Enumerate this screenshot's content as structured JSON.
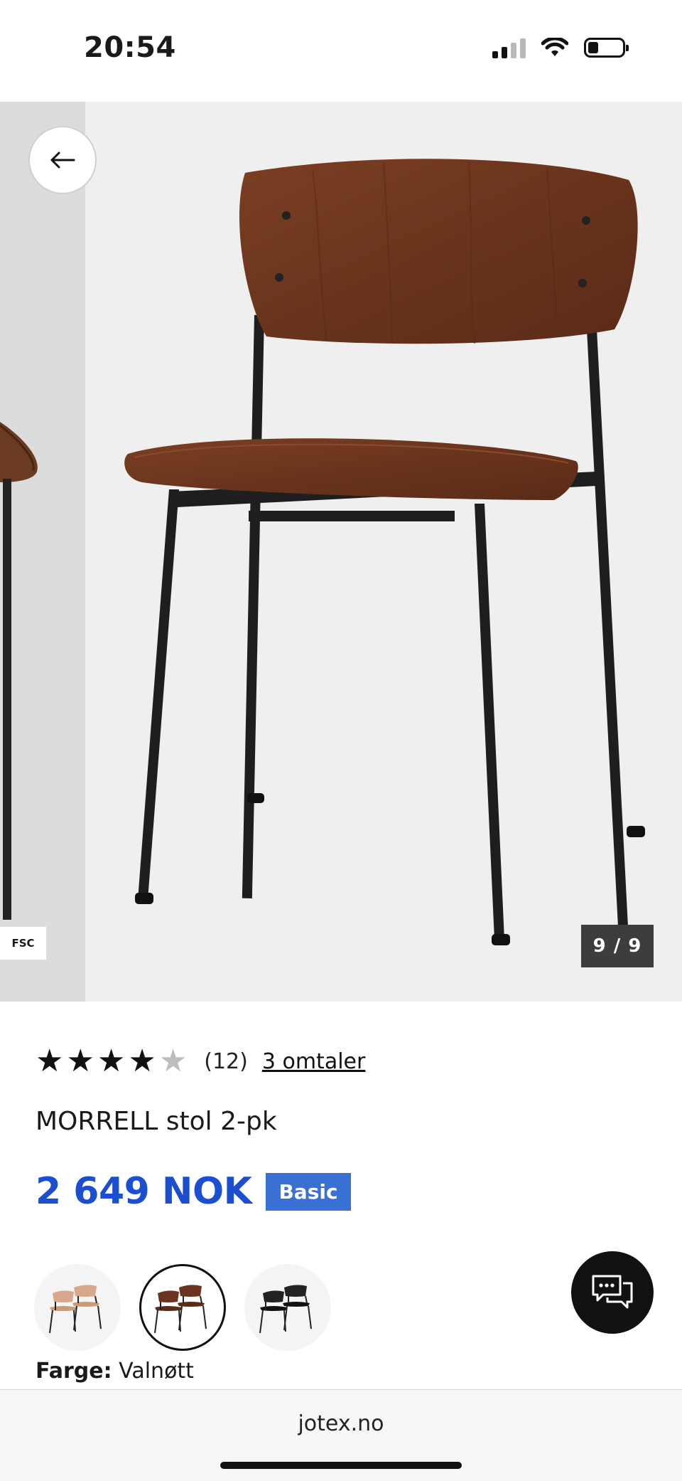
{
  "status_bar": {
    "time": "20:54"
  },
  "gallery": {
    "counter": "9 / 9",
    "fsc_badge": "FSC"
  },
  "product": {
    "rating": 4,
    "rating_max": 5,
    "rating_count": "(12)",
    "reviews_link": "3 omtaler",
    "title": "MORRELL stol 2-pk",
    "price": "2 649 NOK",
    "badge": "Basic"
  },
  "colors": {
    "label": "Farge:",
    "selected": "Valnøtt",
    "options": [
      "light-oak",
      "walnut",
      "black"
    ],
    "selected_index": 1,
    "price_color": "#1b4fd0",
    "badge_color": "#3a6fd3"
  },
  "browser": {
    "url": "jotex.no"
  }
}
